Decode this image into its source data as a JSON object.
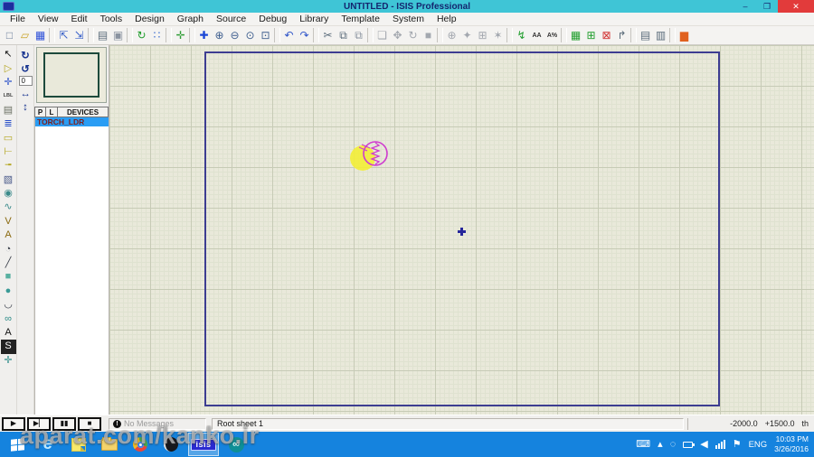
{
  "window": {
    "title": "UNTITLED - ISIS Professional",
    "controls": {
      "minimize": "–",
      "restore": "❐",
      "close": "✕"
    }
  },
  "menu": {
    "items": [
      "File",
      "View",
      "Edit",
      "Tools",
      "Design",
      "Graph",
      "Source",
      "Debug",
      "Library",
      "Template",
      "System",
      "Help"
    ]
  },
  "toolbar": {
    "items": [
      {
        "name": "new-file-button",
        "glyph": "□",
        "color": "#6b7f9c"
      },
      {
        "name": "open-file-button",
        "glyph": "▱",
        "color": "#c9a227"
      },
      {
        "name": "save-file-button",
        "glyph": "▦",
        "color": "#2c4fd8"
      },
      {
        "sep": true
      },
      {
        "name": "import-section-button",
        "glyph": "⇱",
        "color": "#3b62c9"
      },
      {
        "name": "export-section-button",
        "glyph": "⇲",
        "color": "#3b62c9"
      },
      {
        "sep": true
      },
      {
        "name": "print-button",
        "glyph": "▤",
        "color": "#5a6b7a"
      },
      {
        "name": "mark-output-area-button",
        "glyph": "▣",
        "color": "#8a93a0"
      },
      {
        "sep": true
      },
      {
        "name": "redraw-button",
        "glyph": "↻",
        "color": "#1f9d2c"
      },
      {
        "name": "toggle-grid-button",
        "glyph": "∷",
        "color": "#3f6fd0"
      },
      {
        "sep": true
      },
      {
        "name": "false-origin-button",
        "glyph": "✛",
        "color": "#2f9d35"
      },
      {
        "sep": true
      },
      {
        "name": "pan-button",
        "glyph": "✚",
        "color": "#1b47d6"
      },
      {
        "name": "zoom-in-button",
        "glyph": "⊕",
        "color": "#3f5f8f"
      },
      {
        "name": "zoom-out-button",
        "glyph": "⊖",
        "color": "#3f5f8f"
      },
      {
        "name": "zoom-all-button",
        "glyph": "⊙",
        "color": "#3f5f8f"
      },
      {
        "name": "zoom-area-button",
        "glyph": "⊡",
        "color": "#3f5f8f"
      },
      {
        "sep": true
      },
      {
        "name": "undo-button",
        "glyph": "↶",
        "color": "#2f55c9"
      },
      {
        "name": "redo-button",
        "glyph": "↷",
        "color": "#2f55c9"
      },
      {
        "sep": true
      },
      {
        "name": "cut-button",
        "glyph": "✂",
        "color": "#5a6b7a"
      },
      {
        "name": "copy-button",
        "glyph": "⧉",
        "color": "#5a6b7a"
      },
      {
        "name": "paste-button",
        "glyph": "⧉",
        "color": "#8a93a0"
      },
      {
        "sep": true
      },
      {
        "name": "block-copy-button",
        "glyph": "❏",
        "color": "#a3a8af"
      },
      {
        "name": "block-move-button",
        "glyph": "✥",
        "color": "#a3a8af"
      },
      {
        "name": "block-rotate-button",
        "glyph": "↻",
        "color": "#a3a8af"
      },
      {
        "name": "block-delete-button",
        "glyph": "■",
        "color": "#a3a8af"
      },
      {
        "sep": true
      },
      {
        "name": "pick-parts-button",
        "glyph": "⊕",
        "color": "#a3a8af"
      },
      {
        "name": "make-device-button",
        "glyph": "✦",
        "color": "#a3a8af"
      },
      {
        "name": "packaging-tool-button",
        "glyph": "⊞",
        "color": "#a3a8af"
      },
      {
        "name": "decompose-button",
        "glyph": "✶",
        "color": "#a3a8af"
      },
      {
        "sep": true
      },
      {
        "name": "wire-autorouter-button",
        "glyph": "↯",
        "color": "#1f9d2c"
      },
      {
        "name": "search-tag-button",
        "glyph": "AA",
        "color": "#333333",
        "cls": "txt"
      },
      {
        "name": "property-assignment-button",
        "glyph": "A%",
        "color": "#333333",
        "cls": "txt"
      },
      {
        "sep": true
      },
      {
        "name": "design-explorer-button",
        "glyph": "▦",
        "color": "#1f9d2c"
      },
      {
        "name": "new-sheet-button",
        "glyph": "⊞",
        "color": "#1f9d2c"
      },
      {
        "name": "remove-sheet-button",
        "glyph": "⊠",
        "color": "#d03030"
      },
      {
        "name": "goto-sheet-button",
        "glyph": "↱",
        "color": "#5a6b7a"
      },
      {
        "sep": true
      },
      {
        "name": "bill-of-materials-button",
        "glyph": "▤",
        "color": "#5a6b7a"
      },
      {
        "name": "electrical-rule-check-button",
        "glyph": "▥",
        "color": "#5a6b7a"
      },
      {
        "sep": true
      },
      {
        "name": "netlist-to-ares-button",
        "glyph": "▆",
        "color": "#e0611f"
      }
    ]
  },
  "sidebar": {
    "tools": [
      {
        "name": "selection-mode-tool",
        "glyph": "↖",
        "color": "#111111"
      },
      {
        "name": "component-mode-tool",
        "glyph": "▷",
        "color": "#b3a51f"
      },
      {
        "name": "junction-dot-mode-tool",
        "glyph": "✛",
        "color": "#2b51c9"
      },
      {
        "name": "wire-label-mode-tool",
        "glyph": "LBL",
        "color": "#444444",
        "cls": "txt"
      },
      {
        "name": "text-script-mode-tool",
        "glyph": "▤",
        "color": "#6a6f62"
      },
      {
        "name": "buses-mode-tool",
        "glyph": "≣",
        "color": "#2b51c9"
      },
      {
        "name": "subcircuit-mode-tool",
        "glyph": "▭",
        "color": "#b3a51f"
      },
      {
        "name": "terminals-mode-tool",
        "glyph": "⊢",
        "color": "#b3a51f"
      },
      {
        "name": "device-pins-mode-tool",
        "glyph": "╼",
        "color": "#b3a51f"
      },
      {
        "name": "graph-mode-tool",
        "glyph": "▧",
        "color": "#4a5a8a"
      },
      {
        "name": "tape-recorder-mode-tool",
        "glyph": "◉",
        "color": "#3a8a8a"
      },
      {
        "name": "generator-mode-tool",
        "glyph": "∿",
        "color": "#3a8a8a"
      },
      {
        "name": "voltage-probe-mode-tool",
        "glyph": "V",
        "color": "#8a6a10"
      },
      {
        "name": "current-probe-mode-tool",
        "glyph": "A",
        "color": "#8a6a10"
      },
      {
        "name": "virtual-instruments-mode-tool",
        "glyph": "◔",
        "color": "#3a3f4a"
      },
      {
        "name": "2d-line-tool",
        "glyph": "╱",
        "color": "#3a3f4a"
      },
      {
        "name": "2d-box-tool",
        "glyph": "■",
        "color": "#58b0a0"
      },
      {
        "name": "2d-circle-tool",
        "glyph": "●",
        "color": "#3a9a96"
      },
      {
        "name": "2d-arc-tool",
        "glyph": "◡",
        "color": "#3a3f4a"
      },
      {
        "name": "2d-path-tool",
        "glyph": "∞",
        "color": "#2a8a86"
      },
      {
        "name": "2d-text-tool",
        "glyph": "A",
        "color": "#111111"
      },
      {
        "name": "2d-symbol-tool",
        "glyph": "S",
        "color": "#ffffff",
        "bg": "#222222"
      },
      {
        "name": "2d-marker-tool",
        "glyph": "✛",
        "color": "#2a8a86"
      }
    ],
    "orientation": {
      "rotate_cw": "↻",
      "rotate_ccw": "↺",
      "angle": "0",
      "mirror_h": "↔",
      "mirror_v": "↕"
    }
  },
  "object_selector": {
    "pick_label": "P",
    "library_label": "L",
    "header": "DEVICES",
    "devices": [
      {
        "label": "TORCH_LDR",
        "selected": true
      }
    ]
  },
  "canvas": {
    "placed_component": "TORCH_LDR",
    "component_color": "#cf3ccf",
    "torch_color": "#f2ee3a",
    "sheet_border_color": "#3d3d91"
  },
  "status_bar": {
    "play": "▶",
    "step": "▶▏",
    "pause": "�068;▮",
    "pause_glyph": "▮▮",
    "stop": "■",
    "message": "No Messages",
    "message_icon": "!",
    "sheet": "Root sheet 1",
    "coord_x": "-2000.0",
    "coord_y": "+1500.0",
    "units": "th"
  },
  "taskbar": {
    "isis_label": "isis",
    "arduino_glyph": "∞",
    "tray": {
      "keyboard_glyph": "⌨",
      "chevron_glyph": "▴",
      "circle_glyph": "◌",
      "flag_glyph": "⚑",
      "lang": "ENG",
      "time": "10:03 PM",
      "date": "3/26/2016"
    }
  },
  "watermark": "aparat.com/kanko.ir"
}
